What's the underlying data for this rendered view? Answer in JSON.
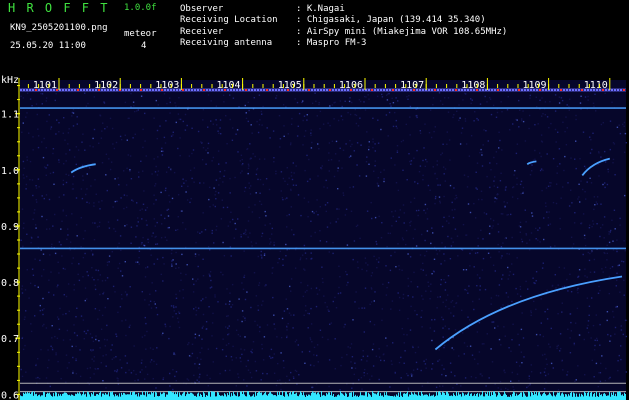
{
  "header": {
    "app_name": "H R O F F T",
    "version": "1.0.0f",
    "filename": "KN9_2505201100.png",
    "datetime": "25.05.20 11:00",
    "meteor_label": "meteor",
    "meteor_count": "4",
    "fields": [
      {
        "label": "Observer",
        "value": ": K.Nagai"
      },
      {
        "label": "Receiving Location",
        "value": ": Chigasaki, Japan (139.414 35.340)"
      },
      {
        "label": "Receiver",
        "value": ": AirSpy mini (Miakejima VOR 108.65MHz)"
      },
      {
        "label": "Receiving antenna",
        "value": ": Maspro FM-3"
      }
    ]
  },
  "chart_data": {
    "type": "heatmap",
    "ylabel": "kHz",
    "yticks": [
      "1.1",
      "1.0",
      "0.9",
      "0.8",
      "0.7",
      "0.6"
    ],
    "xticks": [
      "1101",
      "1102",
      "1103",
      "1104",
      "1105",
      "1106",
      "1107",
      "1108",
      "1109",
      "1110"
    ],
    "ylim": [
      0.59,
      1.16
    ],
    "horizontal_lines_khz": [
      1.11,
      0.86,
      0.62,
      0.605
    ],
    "meteor_traces": [
      {
        "x_minute": 1107.15,
        "khz_start": 0.68,
        "x_minute_end": 1110.2,
        "khz_end": 0.81
      },
      {
        "x_minute": 1109.55,
        "khz_start": 0.99,
        "x_minute_end": 1110.0,
        "khz_end": 1.02
      },
      {
        "x_minute": 1101.2,
        "khz_start": 0.995,
        "x_minute_end": 1101.6,
        "khz_end": 1.01
      },
      {
        "x_minute": 1108.65,
        "khz_start": 1.01,
        "x_minute_end": 1108.8,
        "khz_end": 1.015
      }
    ],
    "colors": {
      "background": "#000000",
      "noise": "#0c0c3c",
      "signal": "#4aa0ff",
      "carrier": "#ff3030",
      "ticks": "#ffff00",
      "baseline": "#33e6ff"
    }
  }
}
